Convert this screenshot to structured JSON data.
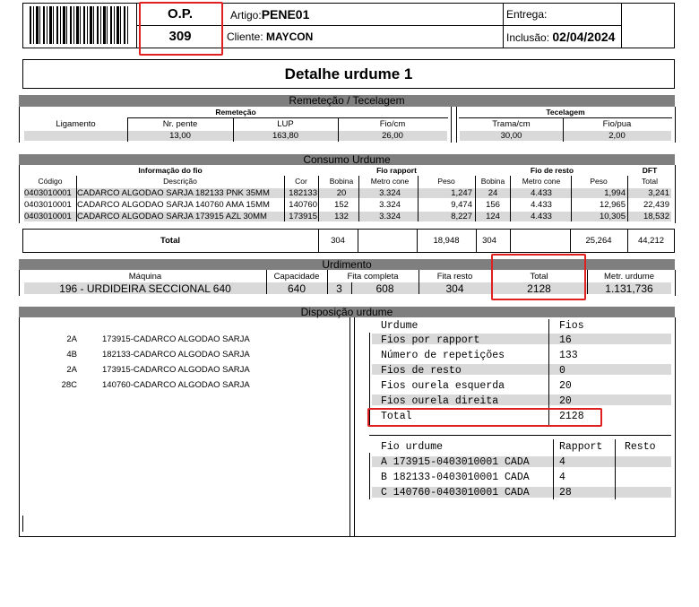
{
  "header": {
    "op_label": "O.P.",
    "op_number": "309",
    "artigo_label": "Artigo:",
    "artigo_value": "PENE01",
    "cliente_label": "Cliente:",
    "cliente_value": "MAYCON",
    "entrega_label": "Entrega:",
    "inclusao_label": "Inclusão:",
    "inclusao_value": "02/04/2024"
  },
  "title": "Detalhe urdume 1",
  "remetecao": {
    "bar": "Remeteção / Tecelagem",
    "group_left": "Remeteção",
    "group_right": "Tecelagem",
    "headers": [
      "Ligamento",
      "Nr. pente",
      "LUP",
      "Fio/cm"
    ],
    "values": [
      "",
      "13,00",
      "163,80",
      "26,00"
    ],
    "tec_headers": [
      "Trama/cm",
      "Fio/pua"
    ],
    "tec_values": [
      "30,00",
      "2,00"
    ]
  },
  "consumo": {
    "bar": "Consumo Urdume",
    "group_info": "Informação do fio",
    "group_rapport": "Fio rapport",
    "group_resto": "Fio de resto",
    "group_dft": "DFT",
    "headers": [
      "Código",
      "Descrição",
      "Cor",
      "Bobina",
      "Metro cone",
      "Peso",
      "Bobina",
      "Metro cone",
      "Peso",
      "Total"
    ],
    "rows": [
      [
        "0403010001",
        "CADARCO ALGODAO SARJA 182133 PNK 35MM",
        "182133",
        "20",
        "3.324",
        "1,247",
        "24",
        "4.433",
        "1,994",
        "3,241"
      ],
      [
        "0403010001",
        "CADARCO ALGODAO SARJA 140760 AMA 15MM",
        "140760",
        "152",
        "3.324",
        "9,474",
        "156",
        "4.433",
        "12,965",
        "22,439"
      ],
      [
        "0403010001",
        "CADARCO ALGODAO SARJA 173915 AZL 30MM",
        "173915",
        "132",
        "3.324",
        "8,227",
        "124",
        "4.433",
        "10,305",
        "18,532"
      ]
    ],
    "total_label": "Total",
    "totals": [
      "304",
      "",
      "18,948",
      "304",
      "",
      "25,264",
      "44,212"
    ]
  },
  "urdimento": {
    "bar": "Urdimento",
    "headers": [
      "Máquina",
      "Capacidade",
      "Fita completa",
      "Fita resto",
      "Total",
      "Metr. urdume"
    ],
    "values": [
      "196 - URDIDEIRA SECCIONAL 640",
      "640",
      "3",
      "608",
      "304",
      "2128",
      "1.131,736"
    ]
  },
  "disposicao": {
    "bar": "Disposição urdume",
    "left_items": [
      {
        "pos": "2A",
        "name": "173915-CADARCO ALGODAO SARJA"
      },
      {
        "pos": "4B",
        "name": "182133-CADARCO ALGODAO SARJA"
      },
      {
        "pos": "2A",
        "name": "173915-CADARCO ALGODAO SARJA"
      },
      {
        "pos": "28C",
        "name": "140760-CADARCO ALGODAO SARJA"
      }
    ],
    "urdume_header": [
      "Urdume",
      "Fios"
    ],
    "urdume_rows": [
      [
        "Fios por rapport",
        "16"
      ],
      [
        "Número de repetições",
        "133"
      ],
      [
        "Fios de resto",
        "0"
      ],
      [
        "Fios ourela esquerda",
        "20"
      ],
      [
        "Fios ourela direita",
        "20"
      ],
      [
        "Total",
        "2128"
      ]
    ],
    "fio_header": [
      "Fio urdume",
      "Rapport",
      "Resto"
    ],
    "fio_rows": [
      [
        "A 173915-0403010001 CADA",
        "4",
        ""
      ],
      [
        "B 182133-0403010001 CADA",
        "4",
        ""
      ],
      [
        "C 140760-0403010001 CADA",
        "28",
        ""
      ]
    ]
  },
  "colors": {
    "bar": "#7f7f7f",
    "stripe": "#d9d9d9",
    "highlight": "#e02020"
  }
}
